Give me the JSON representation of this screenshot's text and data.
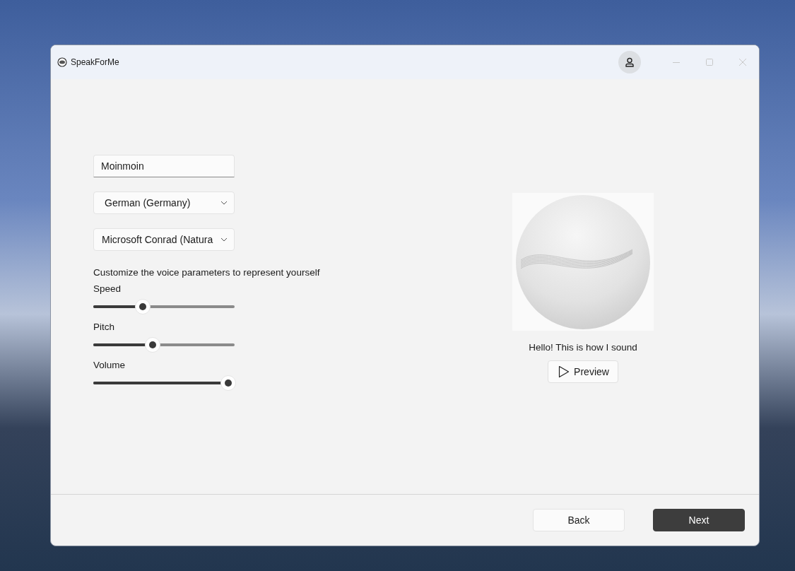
{
  "window": {
    "title": "SpeakForMe"
  },
  "form": {
    "name_field": {
      "value": "Moinmoin"
    },
    "language_dropdown": {
      "value": "German (Germany)"
    },
    "voice_dropdown": {
      "value": "Microsoft Conrad (Natura"
    },
    "hint": "Customize the voice parameters to represent yourself",
    "sliders": [
      {
        "label": "Speed",
        "level": 0.35
      },
      {
        "label": "Pitch",
        "level": 0.42
      },
      {
        "label": "Volume",
        "level": 0.955
      }
    ]
  },
  "preview": {
    "caption": "Hello! This is how I sound",
    "button": "Preview"
  },
  "footer": {
    "buttons": [
      {
        "label": "Back",
        "kind": "secondary"
      },
      {
        "label": "Next",
        "kind": "primary"
      }
    ]
  }
}
